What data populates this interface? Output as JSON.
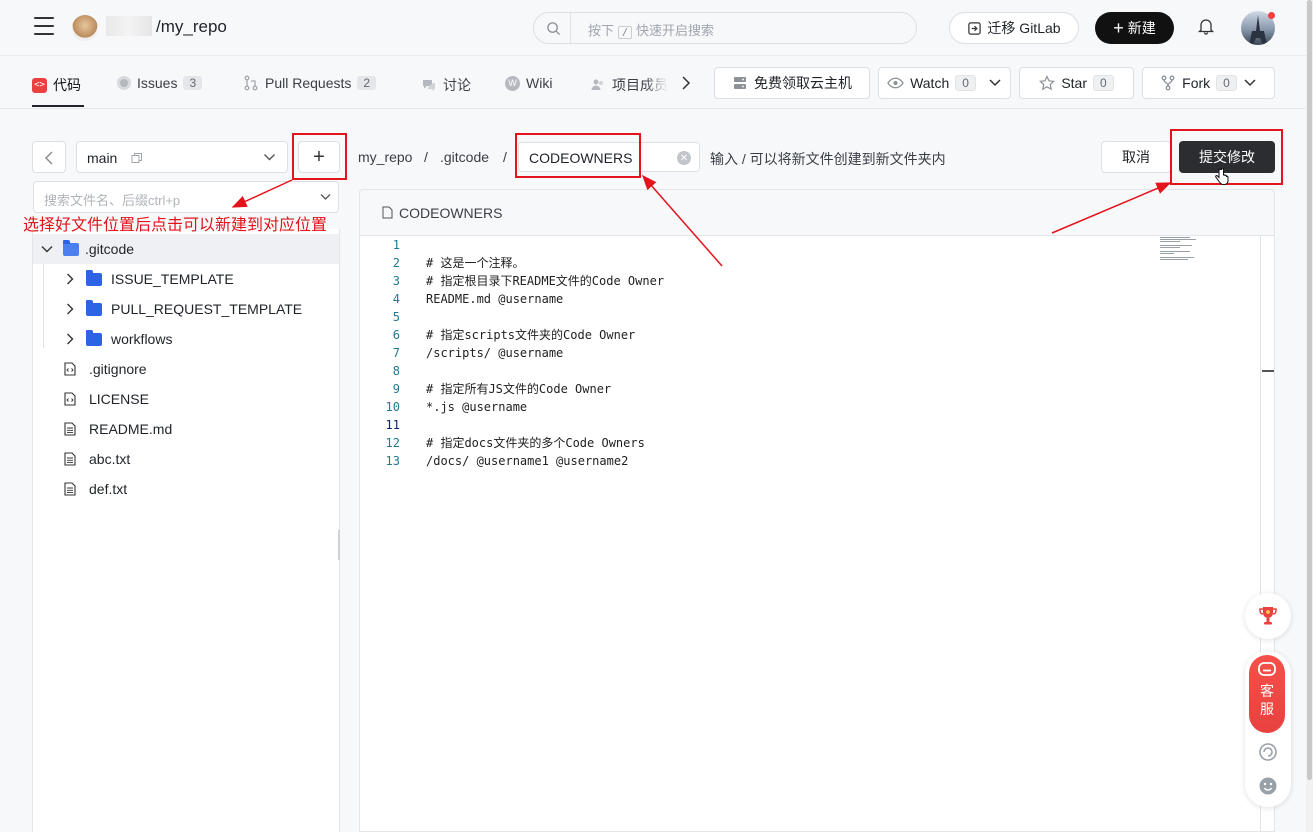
{
  "header": {
    "repo_name": "/my_repo",
    "search_placeholder_before": "按下",
    "search_key": "/",
    "search_placeholder_after": "快速开启搜索",
    "migrate_label": "迁移 GitLab",
    "new_label": "新建"
  },
  "nav": {
    "tabs": [
      {
        "label": "代码"
      },
      {
        "label": "Issues",
        "count": "3"
      },
      {
        "label": "Pull Requests",
        "count": "2"
      },
      {
        "label": "讨论"
      },
      {
        "label": "Wiki"
      },
      {
        "label": "项目成员"
      }
    ],
    "cloud_label": "免费领取云主机",
    "watch_label": "Watch",
    "watch_count": "0",
    "star_label": "Star",
    "star_count": "0",
    "fork_label": "Fork",
    "fork_count": "0"
  },
  "sidebar": {
    "branch": "main",
    "file_search_placeholder": "搜索文件名、后缀ctrl+p",
    "tree": [
      {
        "label": ".gitcode",
        "type": "folder-open"
      },
      {
        "label": "ISSUE_TEMPLATE",
        "type": "folder"
      },
      {
        "label": "PULL_REQUEST_TEMPLATE",
        "type": "folder"
      },
      {
        "label": "workflows",
        "type": "folder"
      },
      {
        "label": ".gitignore",
        "type": "file-code"
      },
      {
        "label": "LICENSE",
        "type": "file-code"
      },
      {
        "label": "README.md",
        "type": "file"
      },
      {
        "label": "abc.txt",
        "type": "file"
      },
      {
        "label": "def.txt",
        "type": "file"
      }
    ]
  },
  "editor": {
    "crumb_repo": "my_repo",
    "crumb_sep": "/",
    "crumb_dir": ".gitcode",
    "filename": "CODEOWNERS",
    "hint": "输入 / 可以将新文件创建到新文件夹内",
    "cancel_label": "取消",
    "commit_label": "提交修改",
    "tab_label": "CODEOWNERS",
    "lines": [
      {
        "n": "1",
        "t": ""
      },
      {
        "n": "2",
        "t": "# 这是一个注释。"
      },
      {
        "n": "3",
        "t": "# 指定根目录下README文件的Code Owner"
      },
      {
        "n": "4",
        "t": "README.md @username"
      },
      {
        "n": "5",
        "t": ""
      },
      {
        "n": "6",
        "t": "# 指定scripts文件夹的Code Owner"
      },
      {
        "n": "7",
        "t": "/scripts/ @username"
      },
      {
        "n": "8",
        "t": ""
      },
      {
        "n": "9",
        "t": "# 指定所有JS文件的Code Owner"
      },
      {
        "n": "10",
        "t": "*.js @username"
      },
      {
        "n": "11",
        "t": ""
      },
      {
        "n": "12",
        "t": "# 指定docs文件夹的多个Code Owners"
      },
      {
        "n": "13",
        "t": "/docs/ @username1 @username2"
      }
    ]
  },
  "annotation": {
    "text": "选择好文件位置后点击可以新建到对应位置",
    "color": "#e3141b"
  },
  "floating": {
    "kefu_line1": "客",
    "kefu_line2": "服"
  }
}
